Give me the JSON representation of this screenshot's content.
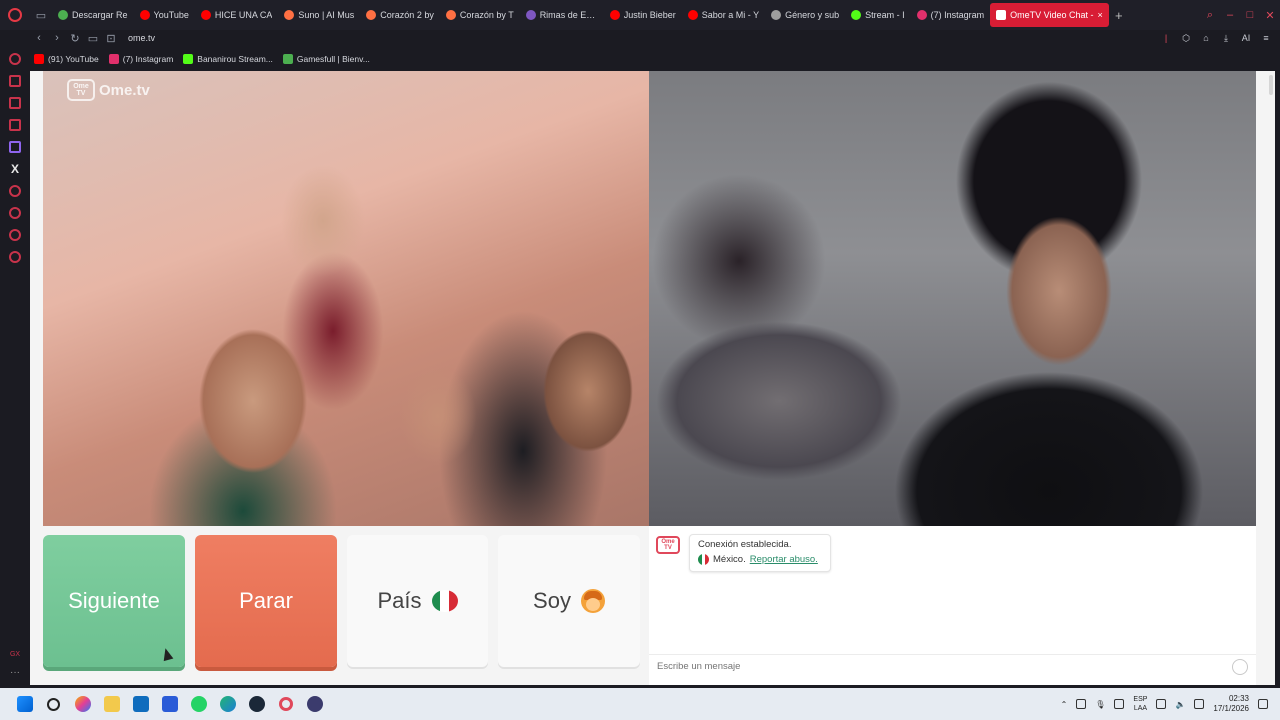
{
  "browser": {
    "tabs": [
      {
        "label": "Descargar Re",
        "color": "#4caf50"
      },
      {
        "label": "YouTube",
        "color": "#ff0000"
      },
      {
        "label": "HICE UNA CA",
        "color": "#ff0000"
      },
      {
        "label": "Suno | AI Mus",
        "color": "#ff7043"
      },
      {
        "label": "Corazón 2 by",
        "color": "#ff7043"
      },
      {
        "label": "Corazón by T",
        "color": "#ff7043"
      },
      {
        "label": "Rimas de Este",
        "color": "#7e57c2"
      },
      {
        "label": "Justin Bieber",
        "color": "#ff0000"
      },
      {
        "label": "Sabor a Mi - Y",
        "color": "#ff0000"
      },
      {
        "label": "Género y sub",
        "color": "#9e9e9e"
      },
      {
        "label": "Stream - I",
        "color": "#53fc18"
      },
      {
        "label": "(7) Instagram",
        "color": "#e1306c"
      }
    ],
    "active_tab": "OmeTV Video Chat -",
    "url": "ome.tv",
    "ai_label": "AI",
    "bookmarks": [
      {
        "label": "(91) YouTube",
        "color": "#ff0000"
      },
      {
        "label": "(7) Instagram",
        "color": "#e1306c"
      },
      {
        "label": "Bananirou Stream...",
        "color": "#53fc18"
      },
      {
        "label": "Gamesfull | Bienv...",
        "color": "#4caf50"
      }
    ],
    "sidebar_bottom": "GX"
  },
  "page": {
    "watermark_tv": "Ome TV",
    "watermark_text": "Ome.tv",
    "buttons": {
      "next": "Siguiente",
      "stop": "Parar",
      "country": "País",
      "soy": "Soy"
    },
    "chat": {
      "logo": "Ome TV",
      "status": "Conexión establecida.",
      "country": "México.",
      "report": "Reportar abuso.",
      "placeholder": "Escribe un mensaje"
    }
  },
  "taskbar": {
    "lang_top": "ESP",
    "lang_bottom": "LAA",
    "time": "02:33",
    "date": "17/1/2026"
  },
  "colors": {
    "accent": "#d81d35",
    "next_button": "#6cc090",
    "stop_button": "#e46b4e",
    "report_link": "#2a8d6a"
  }
}
